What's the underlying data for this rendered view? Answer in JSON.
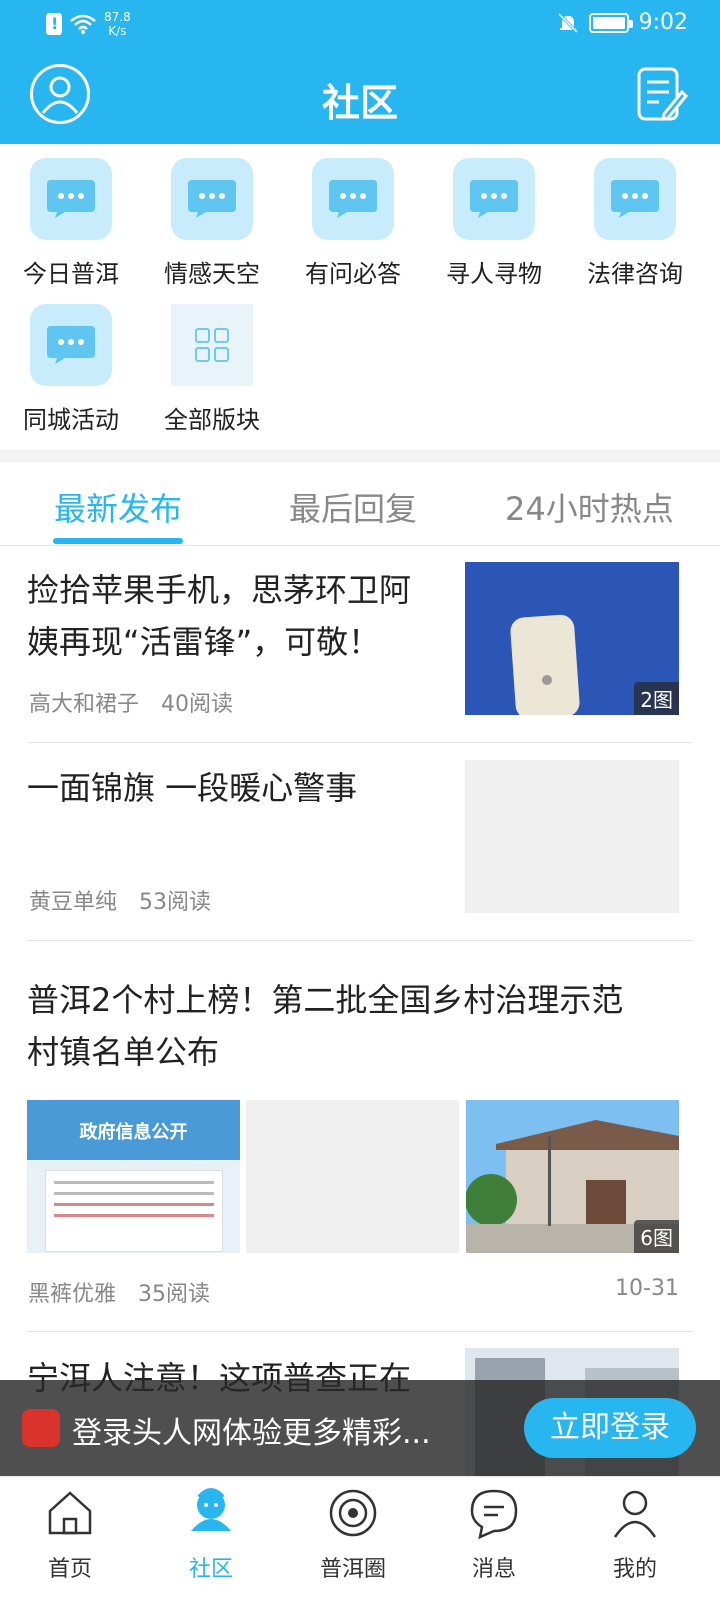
{
  "status_bar": {
    "net_speed_value": "87.8",
    "net_speed_unit": "K/s",
    "time": "9:02"
  },
  "header": {
    "title": "社区"
  },
  "categories": [
    {
      "label": "今日普洱",
      "icon": "chat-bubble-icon"
    },
    {
      "label": "情感天空",
      "icon": "chat-bubble-icon"
    },
    {
      "label": "有问必答",
      "icon": "chat-bubble-icon"
    },
    {
      "label": "寻人寻物",
      "icon": "chat-bubble-icon"
    },
    {
      "label": "法律咨询",
      "icon": "chat-bubble-icon"
    },
    {
      "label": "同城活动",
      "icon": "chat-bubble-icon"
    },
    {
      "label": "全部版块",
      "icon": "grid-icon"
    }
  ],
  "tabs": [
    {
      "label": "最新发布",
      "active": true
    },
    {
      "label": "最后回复",
      "active": false
    },
    {
      "label": "24小时热点",
      "active": false
    }
  ],
  "articles": [
    {
      "title_line1": "捡拾苹果手机，思茅环卫阿",
      "title_line2": "姨再现“活雷锋”，可敬！",
      "author": "高大和裙子",
      "reads": "40阅读",
      "image_count": "2图"
    },
    {
      "title_line1": "一面锦旗 一段暖心警事",
      "author": "黄豆单纯",
      "reads": "53阅读"
    },
    {
      "title_line1": "普洱2个村上榜！第二批全国乡村治理示范",
      "title_line2": "村镇名单公布",
      "author": "黑裤优雅",
      "reads": "35阅读",
      "date": "10-31",
      "image_count": "6图",
      "image_text": "政府信息公开"
    },
    {
      "title_line1": "宁洱人注意！这项普查正在"
    }
  ],
  "login_banner": {
    "message": "登录头人网体验更多精彩...",
    "button": "立即登录"
  },
  "bottom_nav": [
    {
      "label": "首页",
      "active": false
    },
    {
      "label": "社区",
      "active": true
    },
    {
      "label": "普洱圈",
      "active": false
    },
    {
      "label": "消息",
      "active": false
    },
    {
      "label": "我的",
      "active": false
    }
  ],
  "colors": {
    "brand": "#27b6f0",
    "tile": "#c8ecfc",
    "text": "#222222",
    "muted": "#888888"
  }
}
